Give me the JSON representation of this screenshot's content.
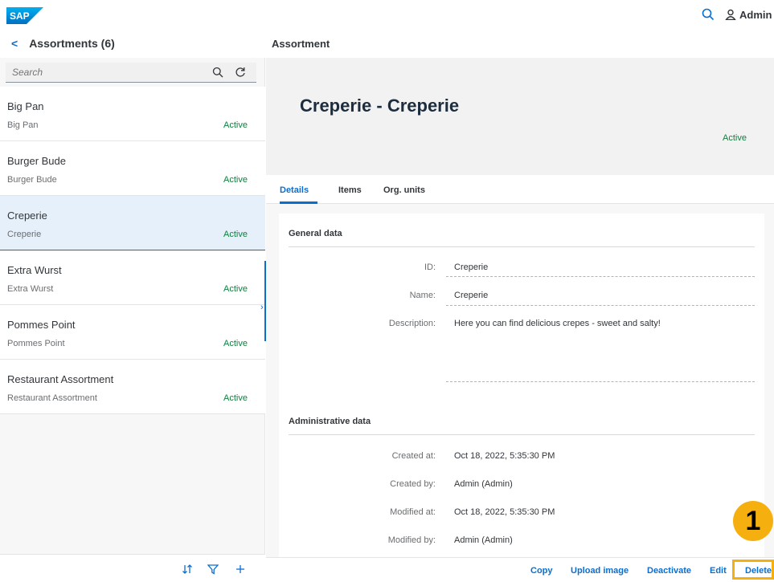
{
  "shell": {
    "logo_text": "SAP",
    "user_label": "Admin",
    "brand_color": "#0a6ed1"
  },
  "master": {
    "title": "Assortments (6)",
    "search_placeholder": "Search",
    "items": [
      {
        "title": "Big Pan",
        "description": "Big Pan",
        "status": "Active"
      },
      {
        "title": "Burger Bude",
        "description": "Burger Bude",
        "status": "Active"
      },
      {
        "title": "Creperie",
        "description": "Creperie",
        "status": "Active",
        "selected": true
      },
      {
        "title": "Extra Wurst",
        "description": "Extra Wurst",
        "status": "Active"
      },
      {
        "title": "Pommes Point",
        "description": "Pommes Point",
        "status": "Active"
      },
      {
        "title": "Restaurant Assortment",
        "description": "Restaurant Assortment",
        "status": "Active"
      }
    ]
  },
  "detail": {
    "page_title": "Assortment",
    "object_title": "Creperie - Creperie",
    "status": "Active",
    "tabs": [
      {
        "label": "Details",
        "active": true
      },
      {
        "label": "Items"
      },
      {
        "label": "Org. units"
      }
    ],
    "general": {
      "title": "General data",
      "id_label": "ID:",
      "id_value": "Creperie",
      "name_label": "Name:",
      "name_value": "Creperie",
      "description_label": "Description:",
      "description_value": "Here you can find delicious crepes - sweet and salty!"
    },
    "admin": {
      "title": "Administrative data",
      "created_at_label": "Created at:",
      "created_at_value": "Oct 18, 2022, 5:35:30 PM",
      "created_by_label": "Created by:",
      "created_by_value": "Admin (Admin)",
      "modified_at_label": "Modified at:",
      "modified_at_value": "Oct 18, 2022, 5:35:30 PM",
      "modified_by_label": "Modified by:",
      "modified_by_value": "Admin (Admin)"
    },
    "footer": {
      "copy": "Copy",
      "upload_image": "Upload image",
      "deactivate": "Deactivate",
      "edit": "Edit",
      "delete": "Delete"
    }
  },
  "annotation": {
    "badge_number": "1",
    "highlight_color": "#f5b010"
  }
}
